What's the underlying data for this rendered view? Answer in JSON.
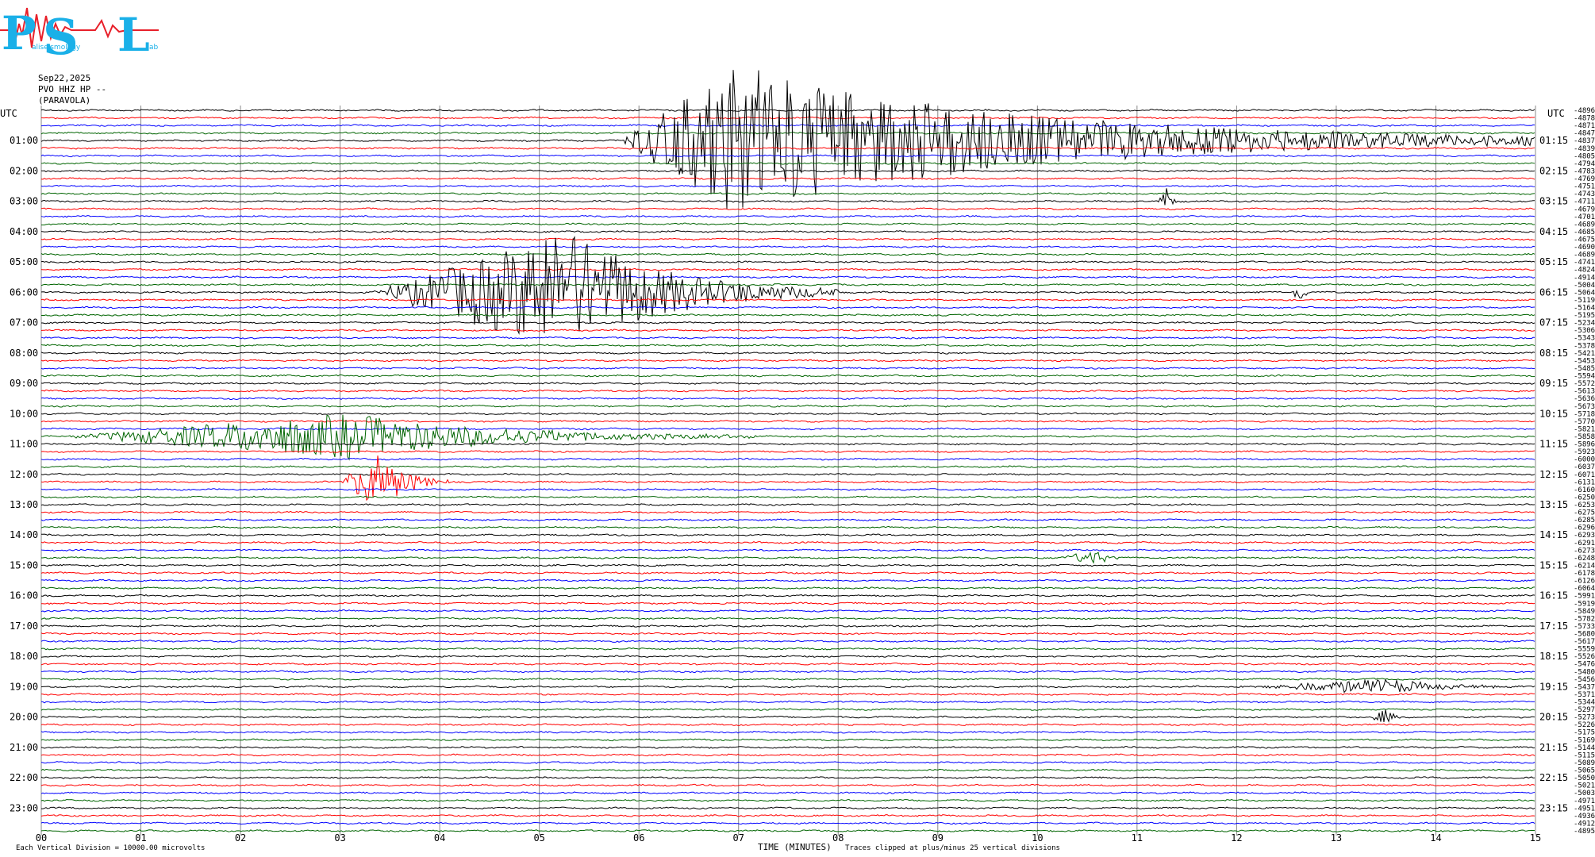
{
  "logo": {
    "letters": [
      "P",
      "S",
      "L"
    ],
    "small_text": [
      "aliseismology",
      "ab"
    ],
    "colors": {
      "letters": "#1ab0e8",
      "trace": "#e8202a"
    }
  },
  "header": {
    "date": "Sep22,2025",
    "station": "PVO HHZ HP --",
    "location": "(PARAVOLA)"
  },
  "utc_label_left": "UTC",
  "utc_label_right": "UTC",
  "footer": {
    "left": "Each Vertical Division = 10000.00 microvolts",
    "center": "TIME (MINUTES)",
    "center_note": "Traces clipped at plus/minus 25 vertical divisions"
  },
  "chart_data": {
    "type": "line",
    "xlabel": "TIME (MINUTES)",
    "xlim": [
      0,
      15
    ],
    "x_ticks": [
      "00",
      "01",
      "02",
      "03",
      "04",
      "05",
      "06",
      "07",
      "08",
      "09",
      "10",
      "11",
      "12",
      "13",
      "14",
      "15"
    ],
    "left_hour_labels": [
      "01:00",
      "02:00",
      "03:00",
      "04:00",
      "05:00",
      "06:00",
      "07:00",
      "08:00",
      "09:00",
      "10:00",
      "11:00",
      "12:00",
      "13:00",
      "14:00",
      "15:00",
      "16:00",
      "17:00",
      "18:00",
      "19:00",
      "20:00",
      "21:00",
      "22:00",
      "23:00"
    ],
    "right_hour_labels": [
      "01:15",
      "02:15",
      "03:15",
      "04:15",
      "05:15",
      "06:15",
      "07:15",
      "08:15",
      "09:15",
      "10:15",
      "11:15",
      "12:15",
      "13:15",
      "14:15",
      "15:15",
      "16:15",
      "17:15",
      "18:15",
      "19:15",
      "20:15",
      "21:15",
      "22:15",
      "23:15"
    ],
    "trace_count": 96,
    "trace_minutes": 15,
    "color_cycle": [
      "#000000",
      "#ff0000",
      "#0000ff",
      "#006400"
    ],
    "offsets": [
      "-4896",
      "-4878",
      "-4871",
      "-4847",
      "-4837",
      "-4839",
      "-4805",
      "-4794",
      "-4783",
      "-4769",
      "-4751",
      "-4743",
      "-4711",
      "-4679",
      "-4701",
      "-4689",
      "-4685",
      "-4675",
      "-4690",
      "-4689",
      "-4741",
      "-4824",
      "-4914",
      "-5004",
      "-5064",
      "-5119",
      "-5164",
      "-5195",
      "-5234",
      "-5306",
      "-5343",
      "-5378",
      "-5421",
      "-5453",
      "-5485",
      "-5594",
      "-5572",
      "-5613",
      "-5636",
      "-5673",
      "-5718",
      "-5770",
      "-5821",
      "-5858",
      "-5896",
      "-5923",
      "-6000",
      "-6037",
      "-6071",
      "-6131",
      "-6160",
      "-6250",
      "-6253",
      "-6275",
      "-6285",
      "-6296",
      "-6293",
      "-6291",
      "-6273",
      "-6248",
      "-6214",
      "-6178",
      "-6126",
      "-6064",
      "-5991",
      "-5919",
      "-5849",
      "-5782",
      "-5733",
      "-5680",
      "-5617",
      "-5559",
      "-5526",
      "-5476",
      "-5480",
      "-5456",
      "-5437",
      "-5371",
      "-5344",
      "-5297",
      "-5273",
      "-5226",
      "-5175",
      "-5169",
      "-5144",
      "-5115",
      "-5089",
      "-5065",
      "-5050",
      "-5021",
      "-5003",
      "-4971",
      "-4951",
      "-4936",
      "-4912",
      "-4895"
    ],
    "events": [
      {
        "trace": 4,
        "start": 5.8,
        "peak": 7.0,
        "end": 15.0,
        "amp": 20,
        "color": "#ff0000"
      },
      {
        "trace": 12,
        "start": 11.2,
        "peak": 11.3,
        "end": 11.4,
        "amp": 4,
        "color": "#000000"
      },
      {
        "trace": 24,
        "start": 3.3,
        "peak": 5.3,
        "end": 8.0,
        "amp": 16,
        "color": "#ff0000"
      },
      {
        "trace": 24,
        "start": 12.55,
        "peak": 12.62,
        "end": 12.7,
        "amp": 4,
        "color": "#000000"
      },
      {
        "trace": 43,
        "start": 0.2,
        "peak": 3.1,
        "end": 7.2,
        "amp": 6,
        "color": "#006400"
      },
      {
        "trace": 49,
        "start": 3.0,
        "peak": 3.4,
        "end": 4.1,
        "amp": 8,
        "color": "#ff0000"
      },
      {
        "trace": 59,
        "start": 10.2,
        "peak": 10.6,
        "end": 10.9,
        "amp": 2,
        "color": "#006400"
      },
      {
        "trace": 76,
        "start": 12.0,
        "peak": 13.5,
        "end": 15.0,
        "amp": 2,
        "color": "#000000"
      },
      {
        "trace": 80,
        "start": 13.3,
        "peak": 13.5,
        "end": 13.7,
        "amp": 2,
        "color": "#000000"
      }
    ]
  }
}
